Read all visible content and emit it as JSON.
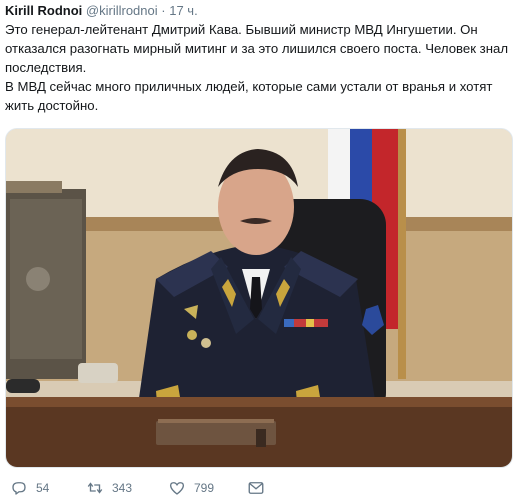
{
  "tweet": {
    "author_name": "Kirill Rodnoi",
    "author_handle": "@kirillrodnoi",
    "separator": "·",
    "time": "17 ч.",
    "text_paragraph_1": "Это генерал-лейтенант Дмитрий Кава. Бывший министр МВД Ингушетии. Он отказался разогнать мирный митинг и за это лишился своего поста. Человек знал последствия.",
    "text_paragraph_2": "В МВД сейчас много приличных людей, которые сами устали от вранья и хотят жить достойно."
  },
  "actions": {
    "reply": {
      "icon": "reply-icon",
      "count": "54"
    },
    "retweet": {
      "icon": "retweet-icon",
      "count": "343"
    },
    "like": {
      "icon": "heart-icon",
      "count": "799"
    },
    "message": {
      "icon": "envelope-icon"
    }
  },
  "colors": {
    "text": "#14171a",
    "secondary": "#657786",
    "border": "#e1e8ed"
  }
}
